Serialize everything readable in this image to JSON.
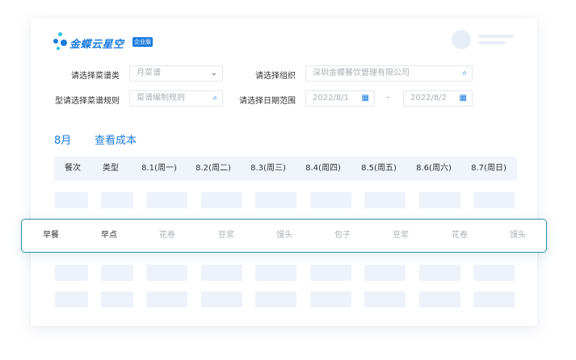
{
  "logo": {
    "text": "金蝶云星空",
    "badge": "企业版"
  },
  "filters": {
    "menu_category_label": "请选择菜谱类",
    "menu_category_value": "月菜谱",
    "org_label": "请选择组织",
    "org_placeholder": "深圳金蝶餐饮管理有限公司",
    "rule_label": "型请选择菜谱规则",
    "rule_placeholder": "菜谱编制规则",
    "date_label": "请选择日期范围",
    "date_start": "2022/8/1",
    "date_end": "2022/8/2",
    "range_separator": "–"
  },
  "header_tabs": {
    "month": "8月",
    "cost": "查看成本"
  },
  "table": {
    "columns": [
      "餐次",
      "类型",
      "8.1(周一)",
      "8.2(周二)",
      "8.3(周三)",
      "8.4(周四)",
      "8.5(周五)",
      "8.6(周六)",
      "8.7(周日)"
    ],
    "highlight_row": [
      "早餐",
      "早点",
      "花卷",
      "豆浆",
      "馒头",
      "包子",
      "豆浆",
      "花卷",
      "馒头"
    ]
  },
  "colors": {
    "accent": "#1a7be0",
    "highlight_border": "#2f8ea6",
    "placeholder_fill": "#edf2fb"
  }
}
